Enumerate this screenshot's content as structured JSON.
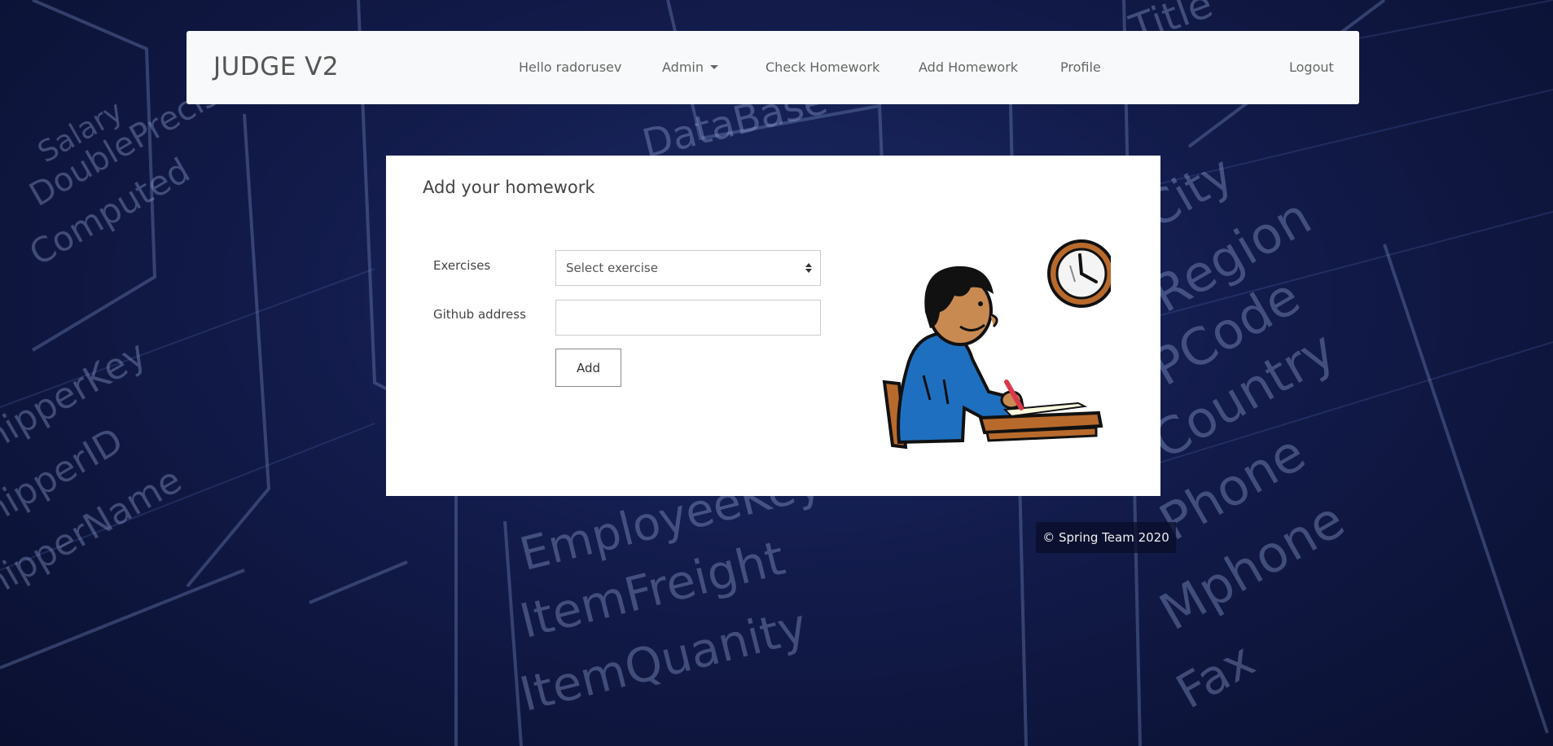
{
  "navbar": {
    "brand": "JUDGE V2",
    "greeting": "Hello radorusev",
    "admin": "Admin",
    "check_homework": "Check Homework",
    "add_homework": "Add Homework",
    "profile": "Profile",
    "logout": "Logout"
  },
  "form": {
    "title": "Add your homework",
    "exercises_label": "Exercises",
    "exercise_select_value": "Select exercise",
    "github_label": "Github address",
    "github_value": "",
    "add_button": "Add"
  },
  "footer": {
    "copyright": "© Spring Team 2020"
  },
  "background": {
    "words": [
      "DataBase",
      "Salary",
      "DoublePrecis",
      "Computed",
      "EmployeeKey",
      "ItemFreight",
      "ItemQuanity",
      "ShipperKey",
      "ShipperID",
      "ShipperName",
      "Region",
      "PCode",
      "Country",
      "Phone",
      "Mphone",
      "Fax",
      "Title",
      "City"
    ]
  },
  "colors": {
    "background": "#121b4a",
    "navbar_bg": "#f8f9fa",
    "card_bg": "#ffffff",
    "shirt_blue": "#1f6fc0",
    "clock_rim": "#b86a2c"
  }
}
